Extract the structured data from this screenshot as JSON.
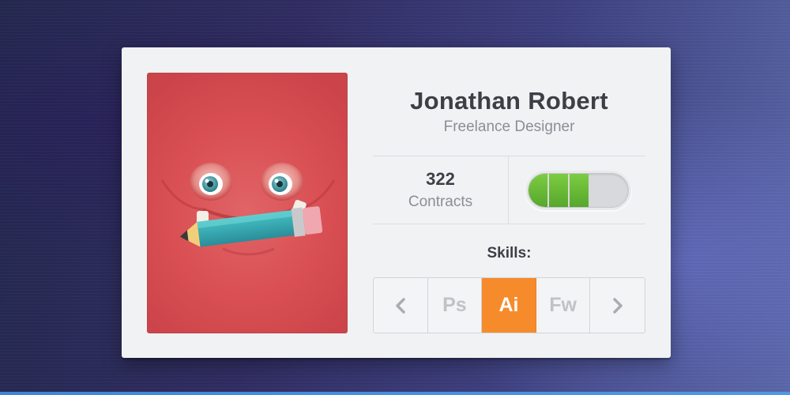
{
  "profile": {
    "name": "Jonathan Robert",
    "role": "Freelance Designer"
  },
  "stats": {
    "contracts_count": "322",
    "contracts_label": "Contracts",
    "level": {
      "filled": 3,
      "total": 5
    }
  },
  "skills": {
    "title": "Skills:",
    "prev_icon": "chevron-left-icon",
    "next_icon": "chevron-right-icon",
    "items": [
      {
        "label": "Ps",
        "active": false
      },
      {
        "label": "Ai",
        "active": true
      },
      {
        "label": "Fw",
        "active": false
      }
    ]
  },
  "colors": {
    "card": "#f1f2f4",
    "avatar_bg": "#d94f53",
    "level_green": "#64b634",
    "active_skill": "#f68b2c",
    "text_dark": "#3c3f45",
    "text_muted": "#8b8e94"
  }
}
